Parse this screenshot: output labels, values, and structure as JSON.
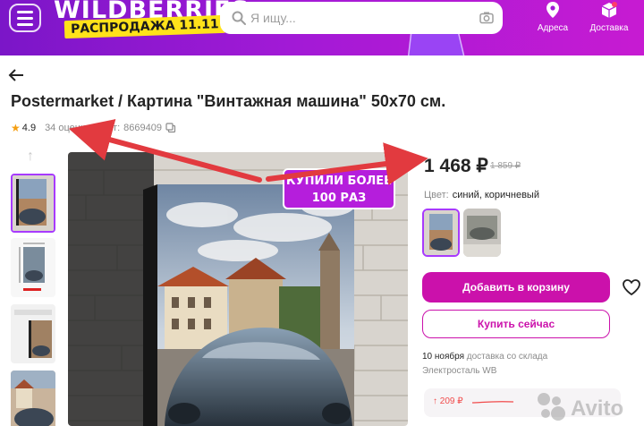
{
  "header": {
    "logo": "WILDBERRIES",
    "sale_badge": "РАСПРОДАЖА 11.11",
    "search_placeholder": "Я ищу...",
    "nav": {
      "address_label": "Адреса",
      "delivery_label": "Доставка"
    },
    "accent_color": "#a21ad6"
  },
  "product": {
    "title": "Postermarket / Картина \"Винтажная машина\" 50x70 см.",
    "rating": "4.9",
    "reviews": "34 оценки",
    "article_label": "Арт:",
    "article": "8669409",
    "price": "1 468 ₽",
    "old_price": "1 859 ₽",
    "color_label": "Цвет:",
    "color_value": "синий, коричневый",
    "promo_line1": "КУПИЛИ БОЛЕЕ",
    "promo_line2": "100 РАЗ",
    "add_to_cart": "Добавить в корзину",
    "buy_now": "Купить сейчас",
    "delivery_date": "10 ноября",
    "delivery_text": "доставка со склада",
    "warehouse": "Электросталь WB",
    "price_drop": "↑ 209 ₽",
    "button_color": "#cb11ab"
  },
  "watermark": "Avito",
  "icons": [
    "menu-icon",
    "search-icon",
    "camera-icon",
    "location-pin-icon",
    "delivery-box-icon",
    "back-arrow-icon",
    "star-icon",
    "copy-icon",
    "heart-icon",
    "chevron-up-icon"
  ]
}
